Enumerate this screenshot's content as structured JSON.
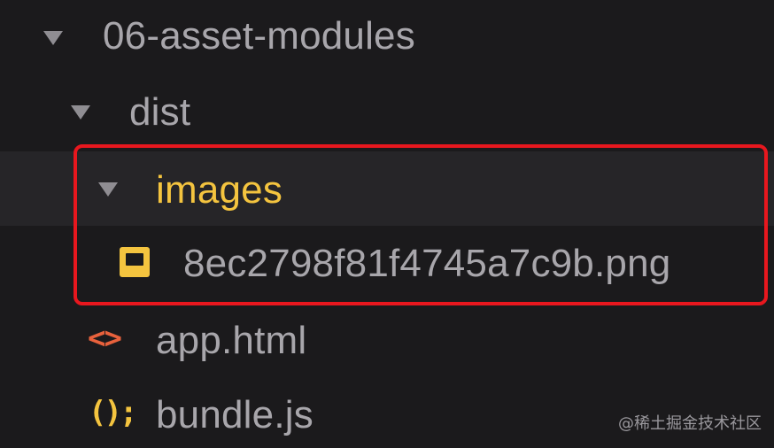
{
  "tree": {
    "root": {
      "label": "06-asset-modules",
      "expanded": true
    },
    "dist": {
      "label": "dist",
      "expanded": true
    },
    "images": {
      "label": "images",
      "expanded": true,
      "color": "#f4c43f"
    },
    "image_file": {
      "label": "8ec2798f81f4745a7c9b.png",
      "icon": "image-file-icon"
    },
    "html_file": {
      "label": "app.html",
      "icon": "html-file-icon",
      "glyph": "<>"
    },
    "js_file": {
      "label": "bundle.js",
      "icon": "js-file-icon",
      "glyph": "();"
    }
  },
  "highlight": {
    "color": "#e8171e"
  },
  "watermark": "@稀土掘金技术社区"
}
